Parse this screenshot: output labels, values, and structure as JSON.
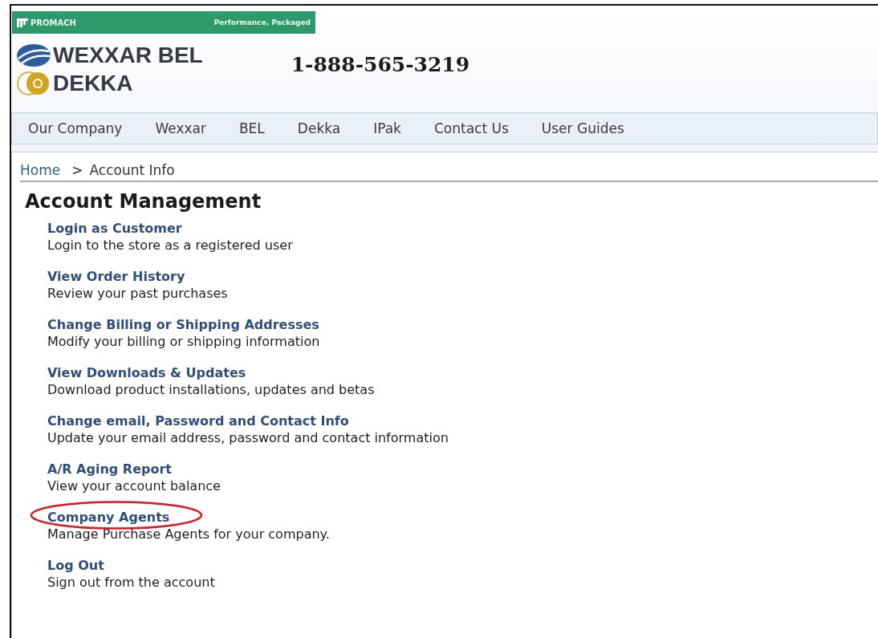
{
  "brand_bar": {
    "logo": "PROMACH",
    "tagline": "Performance, Packaged"
  },
  "logos": [
    "WEXXAR BEL",
    "DEKKA"
  ],
  "phone": "1-888-565-3219",
  "nav": [
    "Our Company",
    "Wexxar",
    "BEL",
    "Dekka",
    "IPak",
    "Contact Us",
    "User Guides"
  ],
  "breadcrumb": {
    "home": "Home",
    "separator": ">",
    "current": "Account Info"
  },
  "heading": "Account Management",
  "items": [
    {
      "title": "Login as Customer",
      "description": "Login to the store as a registered user",
      "highlighted": false
    },
    {
      "title": "View Order History",
      "description": "Review your past purchases",
      "highlighted": false
    },
    {
      "title": "Change Billing or Shipping Addresses",
      "description": "Modify your billing or shipping information",
      "highlighted": false
    },
    {
      "title": "View Downloads & Updates",
      "description": "Download product installations, updates and betas",
      "highlighted": false
    },
    {
      "title": "Change email, Password and Contact Info",
      "description": "Update your email address, password and contact information",
      "highlighted": false
    },
    {
      "title": "A/R Aging Report",
      "description": "View your account balance",
      "highlighted": false
    },
    {
      "title": "Company Agents",
      "description": "Manage Purchase Agents for your company.",
      "highlighted": true
    },
    {
      "title": "Log Out",
      "description": "Sign out from the account",
      "highlighted": false
    }
  ]
}
